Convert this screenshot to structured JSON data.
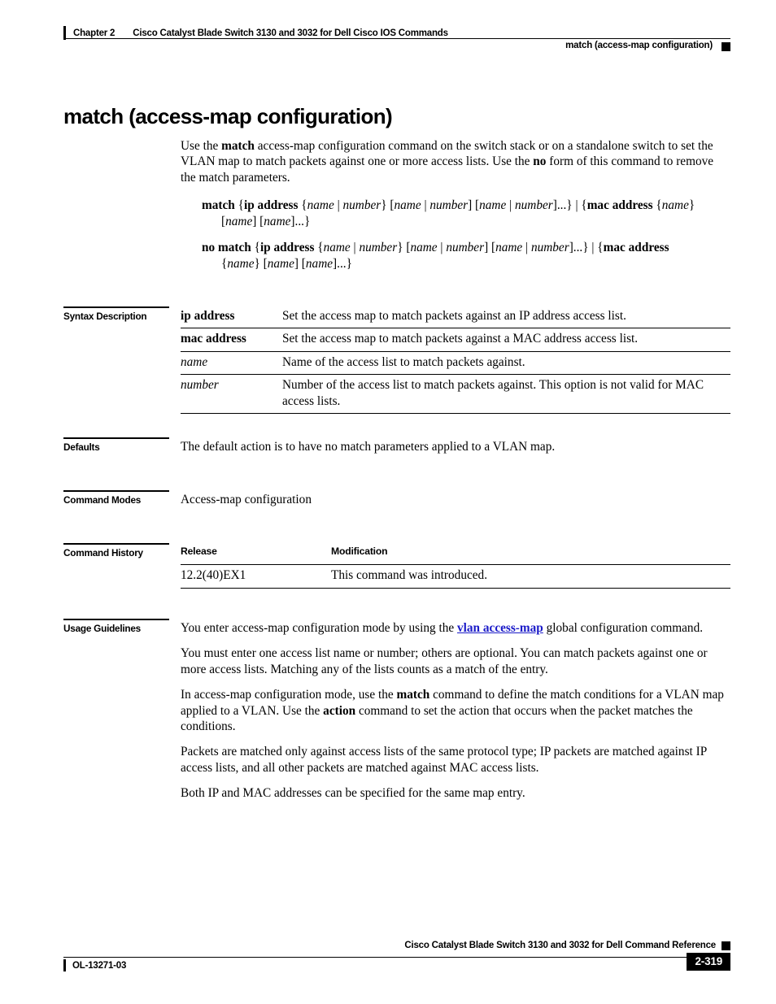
{
  "header": {
    "chapter": "Chapter 2",
    "chapter_title": "Cisco Catalyst Blade Switch 3130 and 3032 for Dell Cisco IOS Commands",
    "running_title": "match (access-map configuration)"
  },
  "command": {
    "title": "match (access-map configuration)",
    "intro_parts": {
      "p1_a": "Use the ",
      "p1_b1": "match",
      "p1_c": " access-map configuration command on the switch stack or on a standalone switch to set the VLAN map to match packets against one or more access lists. Use the ",
      "p1_b2": "no",
      "p1_d": " form of this command to remove the match parameters."
    },
    "syntax": {
      "line1": {
        "bold1": "match",
        "t1": " {",
        "bold2": "ip address",
        "t2": " {",
        "it1": "name",
        "t3": " | ",
        "it2": "number",
        "t4": "} [",
        "it3": "name",
        "t5": " | ",
        "it4": "number",
        "t6": "] [",
        "it5": "name",
        "t7": " | ",
        "it6": "number",
        "t8": "]...} | {",
        "bold3": "mac address",
        "t9": " {",
        "it7": "name",
        "t10": "} ",
        "cont_t1": "[",
        "cont_it1": "name",
        "cont_t2": "] [",
        "cont_it2": "name",
        "cont_t3": "]...}"
      },
      "line2": {
        "bold1": "no match",
        "t1": " {",
        "bold2": "ip address",
        "t2": " {",
        "it1": "name",
        "t3": " | ",
        "it2": "number",
        "t4": "} [",
        "it3": "name",
        "t5": " | ",
        "it4": "number",
        "t6": "] [",
        "it5": "name",
        "t7": " | ",
        "it6": "number",
        "t8": "]...} | {",
        "bold3": "mac address",
        "cont_t1": "{",
        "cont_it1": "name",
        "cont_t2": "} [",
        "cont_it2": "name",
        "cont_t3": "] [",
        "cont_it3": "name",
        "cont_t4": "]...}"
      }
    }
  },
  "sections": {
    "syntax_description": {
      "label": "Syntax Description",
      "rows": [
        {
          "term": "ip address",
          "style": "bold",
          "desc": "Set the access map to match packets against an IP address access list."
        },
        {
          "term": "mac address",
          "style": "bold",
          "desc": "Set the access map to match packets against a MAC address access list."
        },
        {
          "term": "name",
          "style": "italic",
          "desc": "Name of the access list to match packets against."
        },
        {
          "term": "number",
          "style": "italic",
          "desc": "Number of the access list to match packets against. This option is not valid for MAC access lists."
        }
      ]
    },
    "defaults": {
      "label": "Defaults",
      "text": "The default action is to have no match parameters applied to a VLAN map."
    },
    "command_modes": {
      "label": "Command Modes",
      "text": "Access-map configuration"
    },
    "command_history": {
      "label": "Command History",
      "headers": {
        "release": "Release",
        "modification": "Modification"
      },
      "rows": [
        {
          "release": "12.2(40)EX1",
          "modification": "This command was introduced."
        }
      ]
    },
    "usage_guidelines": {
      "label": "Usage Guidelines",
      "p1_a": "You enter access-map configuration mode by using the ",
      "p1_link": "vlan access-map",
      "p1_b": " global configuration command.",
      "p2": "You must enter one access list name or number; others are optional. You can match packets against one or more access lists. Matching any of the lists counts as a match of the entry.",
      "p3_a": "In access-map configuration mode, use the ",
      "p3_b1": "match",
      "p3_b": " command to define the match conditions for a VLAN map applied to a VLAN. Use the ",
      "p3_b2": "action",
      "p3_c": " command to set the action that occurs when the packet matches the conditions.",
      "p4": "Packets are matched only against access lists of the same protocol type; IP packets are matched against IP access lists, and all other packets are matched against MAC access lists.",
      "p5": "Both IP and MAC addresses can be specified for the same map entry."
    }
  },
  "footer": {
    "doc_title": "Cisco Catalyst Blade Switch 3130 and 3032 for Dell Command Reference",
    "doc_number": "OL-13271-03",
    "page_number": "2-319"
  }
}
